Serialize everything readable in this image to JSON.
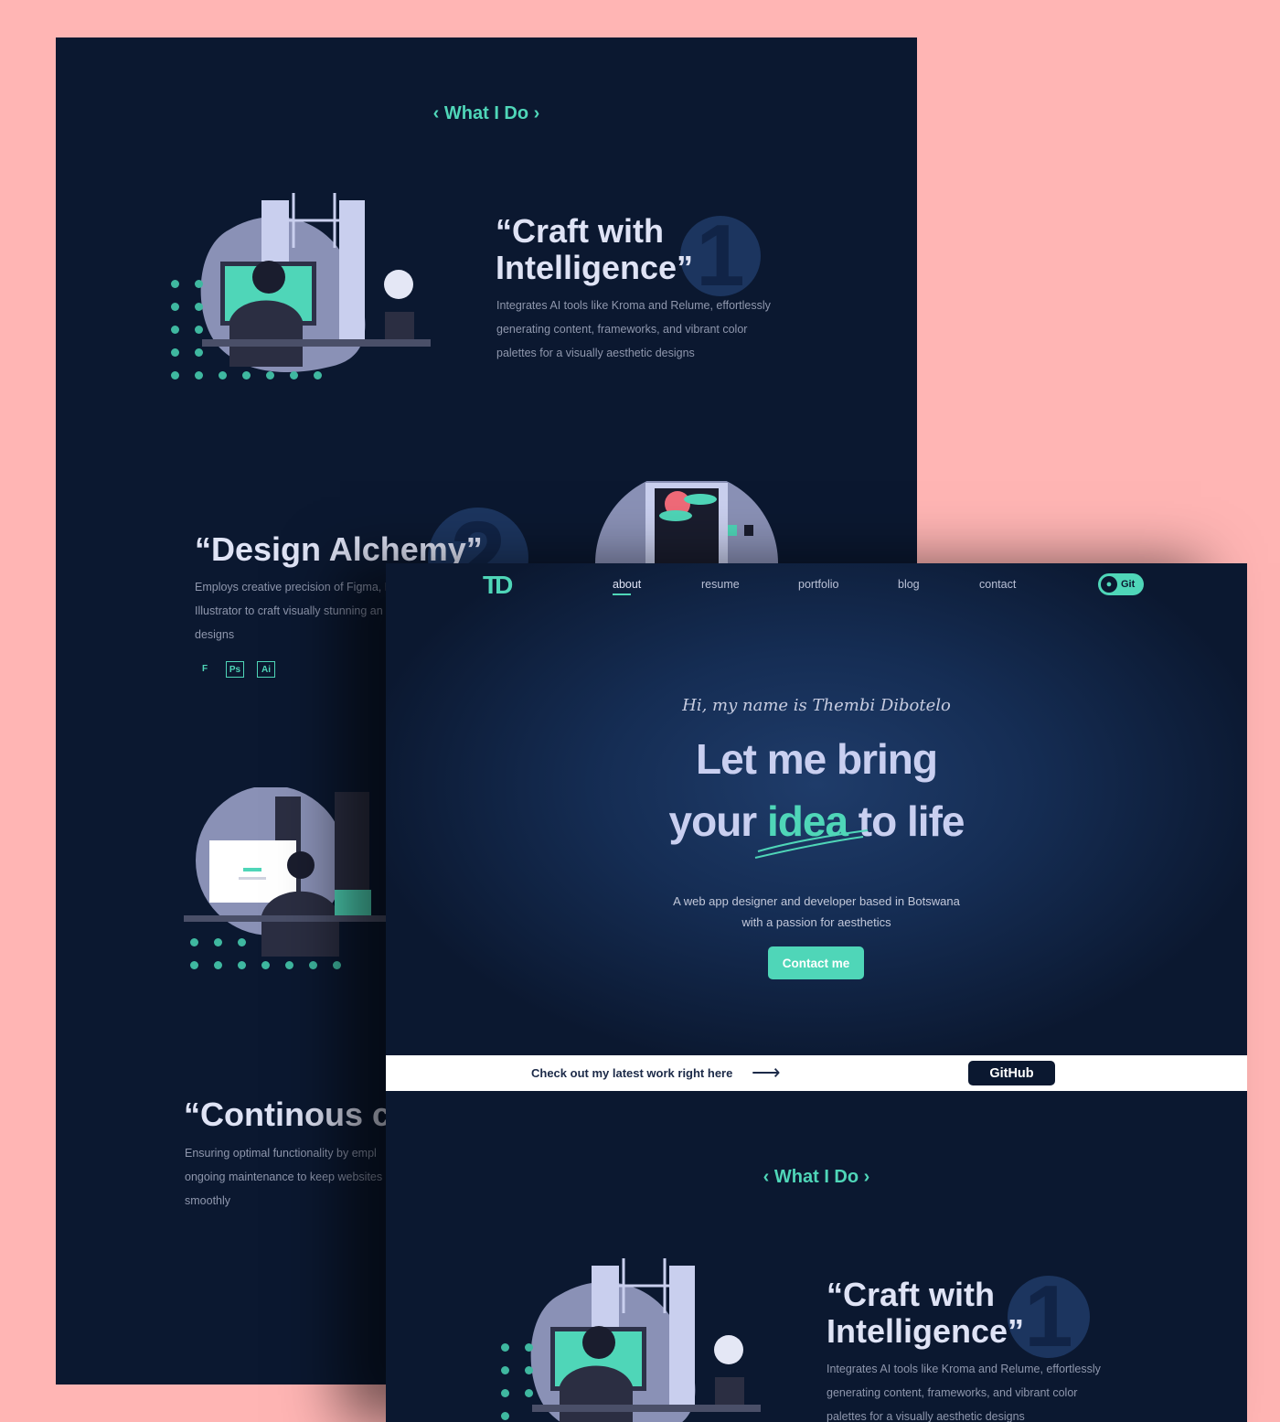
{
  "back_page": {
    "section_title": "‹ What I Do ›",
    "services": [
      {
        "number": "1",
        "title_line1": "“Craft with",
        "title_line2": "Intelligence”",
        "desc_lines": [
          "Integrates AI tools like Kroma and Relume, effortlessly",
          "generating content, frameworks, and vibrant color",
          "palettes for a visually aesthetic designs"
        ]
      },
      {
        "number": "2",
        "title": "“Design Alchemy”",
        "desc_lines": [
          "Employs creative precision of Figma, P",
          "Illustrator to craft visually stunning an",
          "designs"
        ],
        "tools": [
          "F",
          "Ps",
          "Ai"
        ]
      },
      {
        "title": "“Continous c",
        "desc_lines": [
          " Ensuring optimal functionality by empl",
          "ongoing maintenance to keep websites",
          "smoothly"
        ]
      }
    ]
  },
  "front_page": {
    "logo": "TD",
    "nav": [
      "about",
      "resume",
      "portfolio",
      "blog",
      "contact"
    ],
    "nav_active": "about",
    "git_button": "Git",
    "greeting": "Hi, my name is Thembi Dibotelo",
    "headline_line1": "Let me bring",
    "headline_pre": "your ",
    "headline_highlight": "idea",
    "headline_post": " to life",
    "subtext_line1": "A web app designer and developer based in Botswana",
    "subtext_line2": "with a passion for aesthetics",
    "contact_button": "Contact me",
    "banner_text": "Check out my latest work right here",
    "banner_arrow": "⟶",
    "github_button": "GitHub",
    "section_title": "‹ What I Do ›",
    "service": {
      "number": "1",
      "title_line1": "“Craft with",
      "title_line2": "Intelligence”",
      "desc_lines": [
        "Integrates AI tools like Kroma and Relume, effortlessly",
        "generating content, frameworks, and vibrant color",
        "palettes for a visually aesthetic designs"
      ]
    }
  },
  "colors": {
    "background": "#ffb5b4",
    "page": "#0b1830",
    "accent": "#4fd6b8",
    "text": "#dfe3f5"
  }
}
